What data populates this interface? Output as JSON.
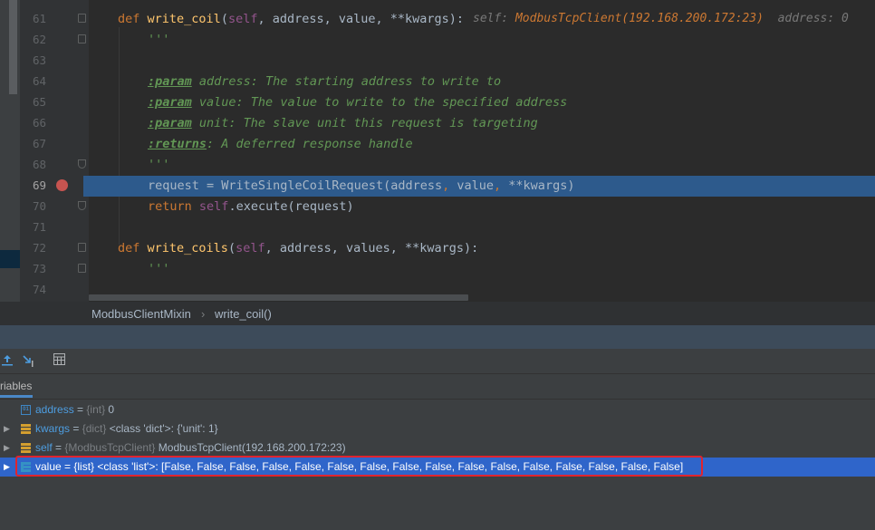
{
  "editor": {
    "lines": [
      {
        "num": "61"
      },
      {
        "num": "62"
      },
      {
        "num": "63"
      },
      {
        "num": "64"
      },
      {
        "num": "65"
      },
      {
        "num": "66"
      },
      {
        "num": "67"
      },
      {
        "num": "68"
      },
      {
        "num": "69"
      },
      {
        "num": "70"
      },
      {
        "num": "71"
      },
      {
        "num": "72"
      },
      {
        "num": "73"
      },
      {
        "num": "74"
      }
    ],
    "code": {
      "l61_def": "def",
      "l61_name": "write_coil",
      "l61_open": "(",
      "l61_self": "self",
      "l61_args": ", address, value, **kwargs):",
      "l61_hint_self": "self: ",
      "l61_hint_self_val": "ModbusTcpClient(192.168.200.172:23)",
      "l61_hint_addr": "address: 0",
      "l62": "'''",
      "l64_tag": ":param",
      "l64_text": " address: The starting address to write to",
      "l65_tag": ":param",
      "l65_text": " value: The value to write to the specified address",
      "l66_tag": ":param",
      "l66_text": " unit: The slave unit this request is targeting",
      "l67_tag": ":returns",
      "l67_text": ": A deferred response handle",
      "l68": "'''",
      "l69_a": "request = WriteSingleCoilRequest(address",
      "l69_c1": ",",
      "l69_b": " value",
      "l69_c2": ",",
      "l69_d": " **kwargs)",
      "l70_ret": "return",
      "l70_self": "self",
      "l70_rest": ".execute(request)",
      "l72_def": "def",
      "l72_name": "write_coils",
      "l72_open": "(",
      "l72_self": "self",
      "l72_args": ", address, values, **kwargs):",
      "l73": "'''"
    },
    "breakpoint_line": "69"
  },
  "breadcrumb": {
    "class_name": "ModbusClientMixin",
    "separator": "›",
    "method_name": "write_coil()"
  },
  "debug": {
    "toolbar": {
      "step_out_icon": "step-out-icon",
      "run_to_cursor_icon": "run-to-cursor-icon",
      "evaluate_icon": "calculator-icon"
    },
    "tab_label": "riables",
    "variables": [
      {
        "name": "address",
        "eq": " = ",
        "type": "{int}",
        "value": " 0",
        "icon": "int"
      },
      {
        "name": "kwargs",
        "eq": " = ",
        "type": "{dict}",
        "value": " <class 'dict'>: {'unit': 1}",
        "icon": "obj"
      },
      {
        "name": "self",
        "eq": " = ",
        "type": "{ModbusTcpClient}",
        "value": " ModbusTcpClient(192.168.200.172:23)",
        "icon": "obj"
      },
      {
        "name": "value",
        "eq": " = ",
        "type": "{list}",
        "value": " <class 'list'>: [False, False, False, False, False, False, False, False, False, False, False, False, False, False, False, False]",
        "icon": "list"
      }
    ]
  },
  "colors": {
    "editor_bg": "#2b2b2b",
    "highlight": "#2d5a8c",
    "selection": "#2f65ca",
    "breakpoint": "#c75450",
    "annotation_box": "#e0242e"
  }
}
